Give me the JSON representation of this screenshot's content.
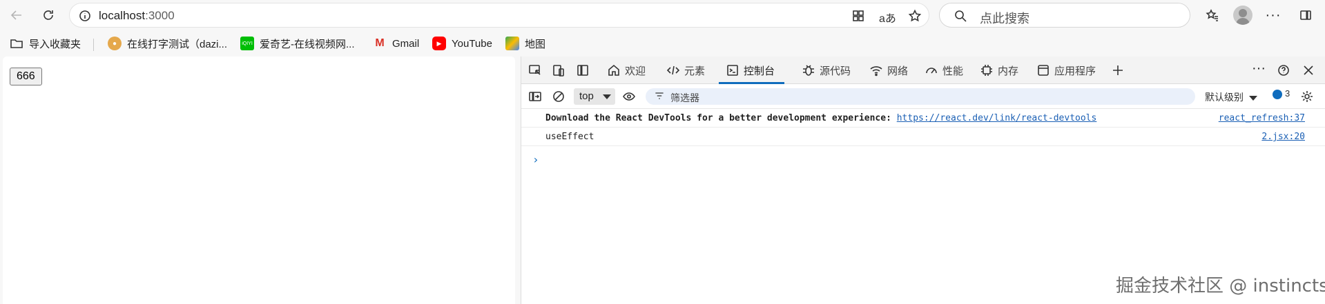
{
  "browser": {
    "url_host": "localhost",
    "url_port": ":3000",
    "search_placeholder": "点此搜索"
  },
  "bookmarks": [
    {
      "label": "导入收藏夹",
      "icon": "folder-import-icon"
    },
    {
      "label": "在线打字测试（dazi...",
      "icon": "favicon-dazi-icon"
    },
    {
      "label": "爱奇艺-在线视频网...",
      "icon": "favicon-iqiyi-icon",
      "badge": "iQIYI",
      "color": "#00be06"
    },
    {
      "label": "Gmail",
      "icon": "gmail-icon"
    },
    {
      "label": "YouTube",
      "icon": "youtube-icon",
      "color": "#ff0000"
    },
    {
      "label": "地图",
      "icon": "maps-icon"
    }
  ],
  "page": {
    "button_label": "666"
  },
  "devtools": {
    "tabs": [
      {
        "label": "欢迎",
        "icon": "home-icon"
      },
      {
        "label": "元素",
        "icon": "code-icon"
      },
      {
        "label": "控制台",
        "icon": "console-icon",
        "active": true
      },
      {
        "label": "源代码",
        "icon": "bug-icon"
      },
      {
        "label": "网络",
        "icon": "wifi-icon"
      },
      {
        "label": "性能",
        "icon": "gauge-icon"
      },
      {
        "label": "内存",
        "icon": "chip-icon"
      },
      {
        "label": "应用程序",
        "icon": "app-window-icon"
      }
    ],
    "context": "top",
    "filter_placeholder": "筛选器",
    "log_level": "默认级别",
    "issues_count": "3",
    "messages": [
      {
        "text": "Download the React DevTools for a better development experience: ",
        "link": "https://react.dev/link/react-devtools",
        "source": "react_refresh:37"
      },
      {
        "text": "useEffect",
        "source": "2.jsx:20"
      }
    ],
    "prompt": "›"
  },
  "watermark": "掘金技术社区 @ instincts",
  "colors": {
    "accent": "#0f6cbd",
    "link": "#1a5fb4"
  }
}
